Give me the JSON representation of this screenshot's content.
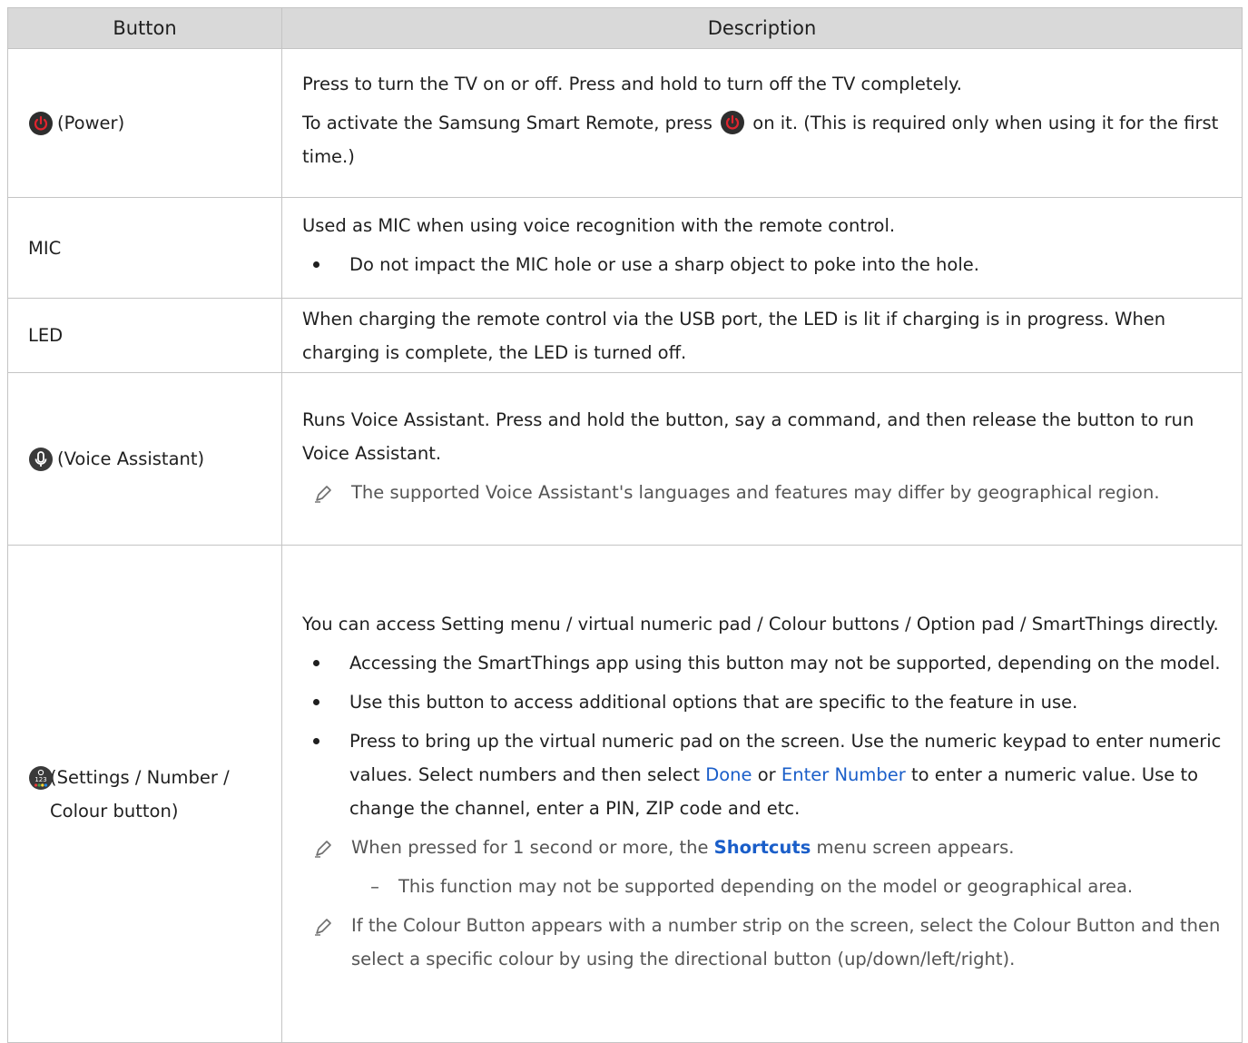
{
  "table": {
    "headers": [
      "Button",
      "Description"
    ],
    "rows": [
      {
        "button": "(Power)",
        "icon": "power-icon",
        "paragraphs": [
          "Press to turn the TV on or off. Press and hold to turn off the TV completely.",
          {
            "before": "To activate the Samsung Smart Remote, press",
            "after": "on it. (This is required only when using it for the first time.)"
          }
        ]
      },
      {
        "button": "MIC",
        "paragraphs": [
          "Used as MIC when using voice recognition with the remote control."
        ],
        "bullets": [
          "Do not impact the MIC hole or use a sharp object to poke into the hole."
        ]
      },
      {
        "button": "LED",
        "paragraphs": [
          "When charging the remote control via the USB port, the LED is lit if charging is in progress. When charging is complete, the LED is turned off."
        ]
      },
      {
        "button": "(Voice Assistant)",
        "icon": "microphone-icon",
        "paragraphs": [
          "Runs Voice Assistant. Press and hold the button, say a command, and then release the button to run Voice Assistant."
        ],
        "notes": [
          "The supported Voice Assistant's languages and features may differ by geographical region."
        ]
      },
      {
        "button": "(Settings / Number / Colour button)",
        "icon": "settings-number-colour-icon",
        "paragraphs": [
          "You can access Setting menu / virtual numeric pad / Colour buttons / Option pad / SmartThings directly."
        ],
        "bullets": [
          "Accessing the SmartThings app using this button may not be supported, depending on the model.",
          "Use this button to access additional options that are specific to the feature in use."
        ],
        "bullet_numeric": {
          "p1": "Press to bring up the virtual numeric pad on the screen. Use the numeric keypad to enter numeric values. Select numbers and then select",
          "done": "Done",
          "or": "or",
          "enter_number": "Enter Number",
          "p2": "to enter a numeric value. Use to change the channel, enter a PIN, ZIP code and etc."
        },
        "note_shortcuts": {
          "before": "When pressed for 1 second or more, the",
          "keyword": "Shortcuts",
          "after": "menu screen appears."
        },
        "subnote": "This function may not be supported depending on the model or geographical area.",
        "note_colour": "If the Colour Button appears with a number strip on the screen, select the Colour Button and then select a specific colour by using the directional button (up/down/left/right)."
      }
    ]
  },
  "colors": {
    "header_bg": "#d9d9d9",
    "border": "#c4c4c4",
    "link_blue": "#1a5ec9",
    "power_red": "#d11a2a"
  }
}
